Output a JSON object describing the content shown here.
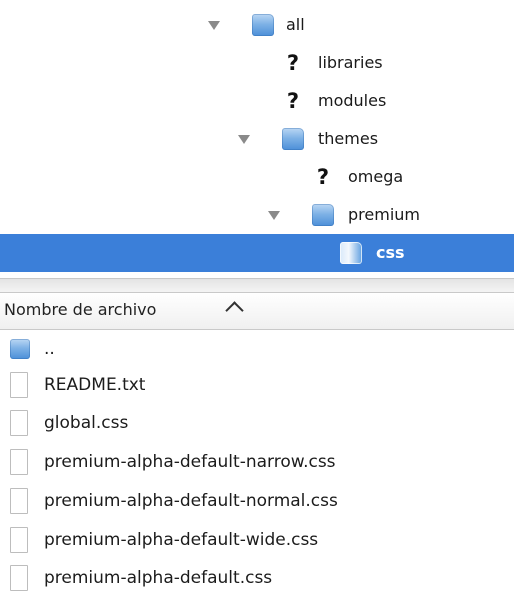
{
  "tree": {
    "items": [
      {
        "label": "all",
        "kind": "folder",
        "expanded": true
      },
      {
        "label": "libraries",
        "kind": "unknown"
      },
      {
        "label": "modules",
        "kind": "unknown"
      },
      {
        "label": "themes",
        "kind": "folder",
        "expanded": true
      },
      {
        "label": "omega",
        "kind": "unknown"
      },
      {
        "label": "premium",
        "kind": "folder",
        "expanded": true
      },
      {
        "label": "css",
        "kind": "folder-open",
        "selected": true
      }
    ]
  },
  "file_list": {
    "column_header": "Nombre de archivo",
    "sort_direction": "ascending",
    "items": [
      {
        "name": "..",
        "kind": "folder"
      },
      {
        "name": "README.txt",
        "kind": "file"
      },
      {
        "name": "global.css",
        "kind": "file"
      },
      {
        "name": "premium-alpha-default-narrow.css",
        "kind": "file"
      },
      {
        "name": "premium-alpha-default-normal.css",
        "kind": "file"
      },
      {
        "name": "premium-alpha-default-wide.css",
        "kind": "file"
      },
      {
        "name": "premium-alpha-default.css",
        "kind": "file"
      }
    ]
  },
  "colors": {
    "selection": "#3b7fd9",
    "folder": "#5b9be0"
  }
}
